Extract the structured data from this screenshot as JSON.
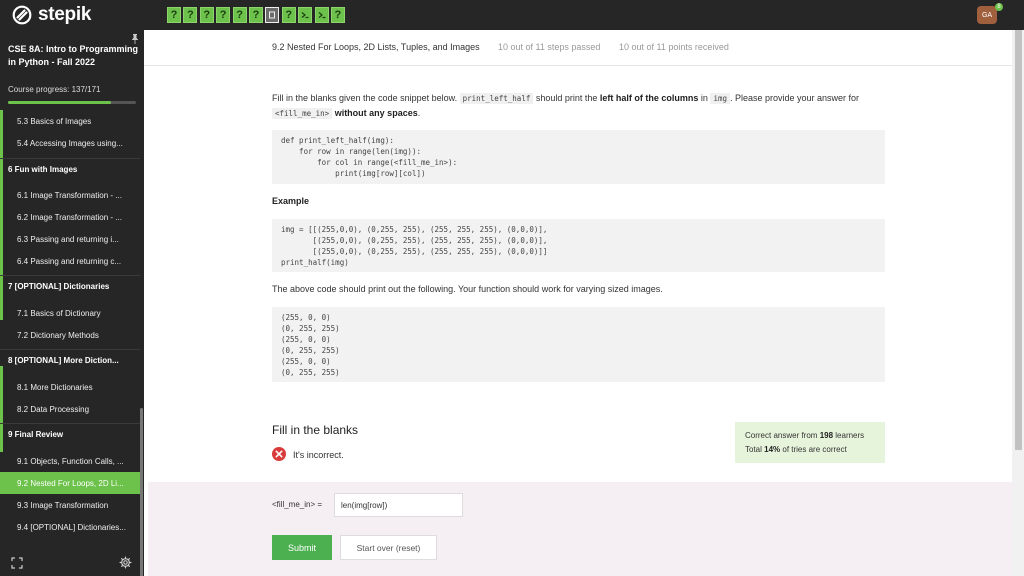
{
  "brand": {
    "name": "stepik"
  },
  "topbar": {
    "steps": [
      {
        "kind": "question",
        "label": "?"
      },
      {
        "kind": "question",
        "label": "?"
      },
      {
        "kind": "question",
        "label": "?"
      },
      {
        "kind": "question",
        "label": "?"
      },
      {
        "kind": "question",
        "label": "?"
      },
      {
        "kind": "question",
        "label": "?"
      },
      {
        "kind": "current",
        "label": ""
      },
      {
        "kind": "question",
        "label": "?"
      },
      {
        "kind": "code",
        "label": ""
      },
      {
        "kind": "code",
        "label": ""
      },
      {
        "kind": "question",
        "label": "?"
      }
    ],
    "avatar_initials": "GA",
    "notification_count": "8"
  },
  "sidebar": {
    "course_title": "CSE 8A: Intro to Programming in Python - Fall 2022",
    "progress_text": "Course progress:  137/171",
    "progress_fraction": 0.801,
    "items": [
      {
        "type": "item",
        "label": "5.3  Basics of Images"
      },
      {
        "type": "item",
        "label": "5.4  Accessing Images using..."
      },
      {
        "type": "section",
        "label": "6  Fun with Images"
      },
      {
        "type": "item",
        "label": "6.1  Image Transformation - ..."
      },
      {
        "type": "item",
        "label": "6.2  Image Transformation - ..."
      },
      {
        "type": "item",
        "label": "6.3  Passing and returning i..."
      },
      {
        "type": "item",
        "label": "6.4  Passing and returning c..."
      },
      {
        "type": "section",
        "label": "7  [OPTIONAL] Dictionaries"
      },
      {
        "type": "item",
        "label": "7.1  Basics of Dictionary"
      },
      {
        "type": "item",
        "label": "7.2  Dictionary Methods"
      },
      {
        "type": "section",
        "label": "8  [OPTIONAL] More Diction..."
      },
      {
        "type": "item",
        "label": "8.1  More Dictionaries"
      },
      {
        "type": "item",
        "label": "8.2  Data Processing"
      },
      {
        "type": "section",
        "label": "9  Final Review"
      },
      {
        "type": "item",
        "label": "9.1  Objects, Function Calls, ..."
      },
      {
        "type": "item",
        "label": "9.2  Nested For Loops, 2D Li...",
        "active": true
      },
      {
        "type": "item",
        "label": "9.3  Image Transformation"
      },
      {
        "type": "item",
        "label": "9.4  [OPTIONAL] Dictionaries..."
      }
    ]
  },
  "lesson": {
    "title": "9.2 Nested For Loops, 2D Lists, Tuples, and Images",
    "steps_passed": "10 out of 11 steps passed",
    "points_received": "10 out of 11 points  received"
  },
  "problem": {
    "intro_pre": "Fill in the blanks given the code snippet below. ",
    "intro_code1": "print_left_half",
    "intro_mid1": " should print the ",
    "intro_bold1": "left half of the columns",
    "intro_mid2": " in ",
    "intro_code2": "img",
    "intro_mid3": ". Please provide your answer for ",
    "intro_code3": "<fill_me_in>",
    "intro_bold2": " without any spaces",
    "intro_end": ".",
    "code_lines": [
      "def print_left_half(img):",
      "    for row in range(len(img)):",
      "        for col in range(<fill_me_in>):",
      "            print(img[row][col])"
    ],
    "example_label": "Example",
    "example_lines": [
      "img = [[(255,0,0), (0,255, 255), (255, 255, 255), (0,0,0)],",
      "       [(255,0,0), (0,255, 255), (255, 255, 255), (0,0,0)],",
      "       [(255,0,0), (0,255, 255), (255, 255, 255), (0,0,0)]]",
      "print_half(img)"
    ],
    "output_intro": "The above code should print out the following. Your function should work for varying sized images.",
    "output_lines": [
      "(255, 0, 0)",
      "(0, 255, 255)",
      "(255, 0, 0)",
      "(0, 255, 255)",
      "(255, 0, 0)",
      "(0, 255, 255)"
    ]
  },
  "feedback": {
    "title": "Fill in the blanks",
    "status": "It's incorrect.",
    "stats_pre": "Correct answer from ",
    "stats_count": "198",
    "stats_post": " learners",
    "stats2_pre": "Total ",
    "stats2_pct": "14%",
    "stats2_post": " of tries are correct"
  },
  "answer": {
    "label": "<fill_me_in> =",
    "value": "len(img[row])",
    "submit_label": "Submit",
    "reset_label": "Start over (reset)"
  },
  "colors": {
    "accent": "#6cc24a",
    "dark": "#262626",
    "error": "#d93b3b"
  }
}
